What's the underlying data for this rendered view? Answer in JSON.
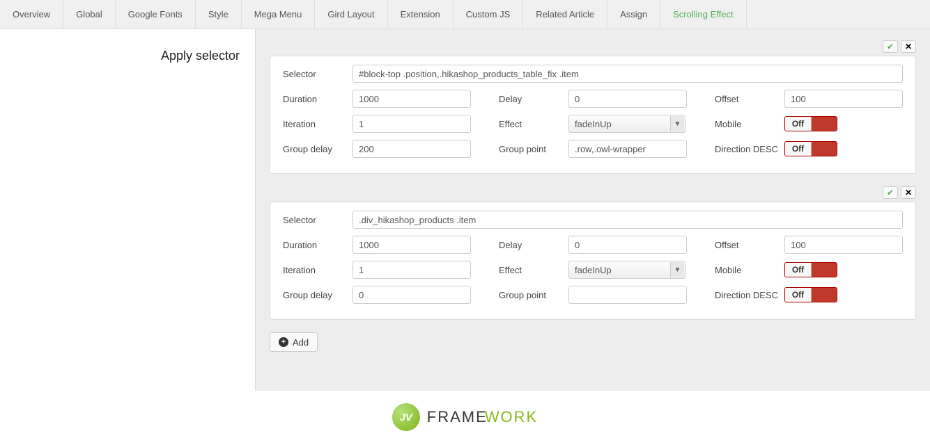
{
  "tabs": {
    "items": [
      "Overview",
      "Global",
      "Google Fonts",
      "Style",
      "Mega Menu",
      "Gird Layout",
      "Extension",
      "Custom JS",
      "Related Article",
      "Assign",
      "Scrolling Effect"
    ],
    "active_index": 10
  },
  "sidebar": {
    "title": "Apply selector"
  },
  "labels": {
    "selector": "Selector",
    "duration": "Duration",
    "delay": "Delay",
    "offset": "Offset",
    "iteration": "Iteration",
    "effect": "Effect",
    "mobile": "Mobile",
    "group_delay": "Group delay",
    "group_point": "Group point",
    "direction_desc": "Direction DESC",
    "add": "Add",
    "off": "Off"
  },
  "groups": [
    {
      "selector": "#block-top .position,.hikashop_products_table_fix .item",
      "duration": "1000",
      "delay": "0",
      "offset": "100",
      "iteration": "1",
      "effect": "fadeInUp",
      "mobile": "Off",
      "group_delay": "200",
      "group_point": ".row,.owl-wrapper",
      "direction_desc": "Off"
    },
    {
      "selector": ".div_hikashop_products .item",
      "duration": "1000",
      "delay": "0",
      "offset": "100",
      "iteration": "1",
      "effect": "fadeInUp",
      "mobile": "Off",
      "group_delay": "0",
      "group_point": "",
      "direction_desc": "Off"
    }
  ],
  "footer": {
    "badge": "JV",
    "word1": "FRAME",
    "word2": "WORK"
  }
}
